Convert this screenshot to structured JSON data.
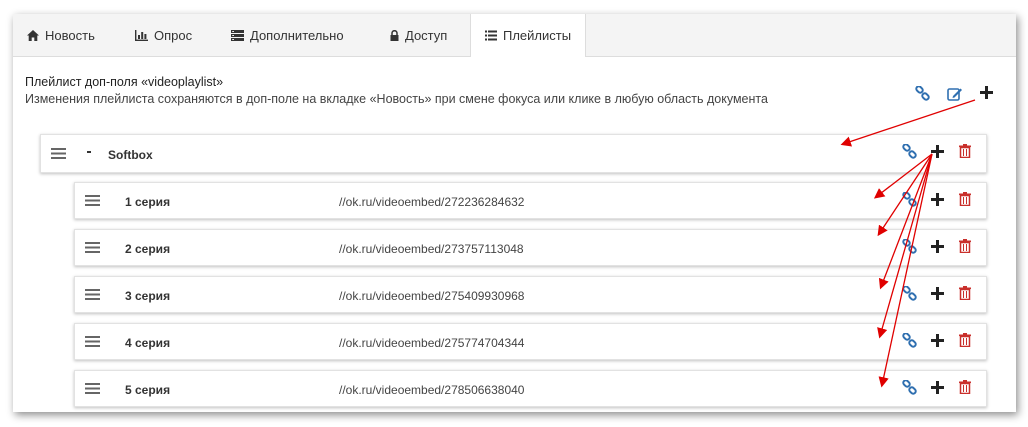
{
  "tabs": [
    {
      "label": "Новость",
      "icon": "home-icon"
    },
    {
      "label": "Опрос",
      "icon": "bar-chart-icon"
    },
    {
      "label": "Дополнительно",
      "icon": "list-box-icon"
    },
    {
      "label": "Доступ",
      "icon": "lock-icon"
    },
    {
      "label": "Плейлисты",
      "icon": "list-icon",
      "active": true
    }
  ],
  "header": {
    "title": "Плейлист доп-поля «videoplaylist»",
    "subtitle": "Изменения плейлиста сохраняются в доп-поле на вкладке «Новость» при смене фокуса или клике в любую область документа"
  },
  "playlist": {
    "title": "Softbox",
    "collapse_symbol": "-",
    "items": [
      {
        "title": "1 серия",
        "url": "//ok.ru/videoembed/272236284632"
      },
      {
        "title": "2 серия",
        "url": "//ok.ru/videoembed/273757113048"
      },
      {
        "title": "3 серия",
        "url": "//ok.ru/videoembed/275409930968"
      },
      {
        "title": "4 серия",
        "url": "//ok.ru/videoembed/275774704344"
      },
      {
        "title": "5 серия",
        "url": "//ok.ru/videoembed/278506638040"
      }
    ]
  },
  "colors": {
    "link_icon": "#2f6fb0",
    "edit_icon": "#2f6fb0",
    "delete_icon": "#c9302c",
    "annotation_arrow": "#e00000",
    "tab_bar_bg": "#f4f4f4"
  }
}
